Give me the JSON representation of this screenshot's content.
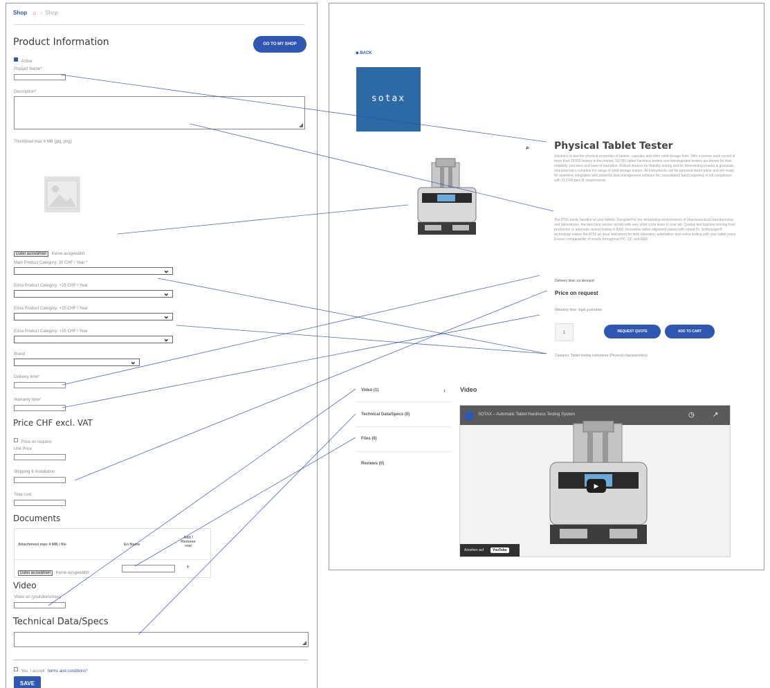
{
  "breadcrumb": {
    "shop": "Shop",
    "separator": "›",
    "current": "Shop"
  },
  "form": {
    "title": "Product Information",
    "go_to_shop": "GO TO MY SHOP",
    "active_label": "Active",
    "product_name_label": "Product Name*",
    "description_label": "Description*",
    "thumbnail_label": "Thumbnail max 4 MB (jpg, png)",
    "file_button": "Datei auswählen",
    "file_status": "Keine ausgewählt",
    "main_category_label": "Main Product Category: 30 CHF / Year *",
    "extra_category_label_1": "Extra Product Category: +25 CHF / Year",
    "extra_category_label_2": "Extra Product Category: +25 CHF / Year",
    "extra_category_label_3": "Extra Product Category: +25 CHF / Year",
    "brand_label": "Brand",
    "delivery_label": "Delivery time*",
    "warranty_label": "Warranty time*",
    "price_title": "Price CHF excl. VAT",
    "price_on_request": "Price on request",
    "unit_price_label": "Unit Price",
    "shipping_label": "Shipping & Installation",
    "total_label": "Total cost",
    "documents_title": "Documents",
    "doc_col_attachment": "Attachment max 4 MB / file",
    "doc_col_name": "En Name",
    "doc_col_add": "Add / Remove row",
    "doc_add_icon": "+",
    "video_title": "Video",
    "video_url_label": "Video url (youtube/vimeo)",
    "tech_title": "Technical Data/Specs",
    "accept_prefix": "Yes, I accept",
    "accept_link": "terms and conditions*",
    "save": "SAVE"
  },
  "preview": {
    "back": "◆ BACK",
    "logo_text": "sotax",
    "search_icon": "search-icon",
    "product_title": "Physical Tablet Tester",
    "desc_1": "Solutions to test the physical properties of tablets, capsules and other solid dosage form. With a proven track record of more than 25'000 testers in the market, SOTAX tablet hardness testers and disintegration testers are known for their reliability, precision and ease of operation. Robust devices for friability testing and for determining powder & granulate characteristics complete the range of solid dosage testers. All instruments can be operated stand-alone and are ready for seamless integration with powerful data management software for consolidated batch reporting in full compliance with 21 CFR part 11 requirements.",
    "desc_2": "The AT50 easily handles all your tablets. Designed for the demanding environments of pharmaceutical manufacturing and laboratories, the benchtop version avoids with very short cycle times in your lab. Quickly test batches arriving from production or automate repeat testing in R&D. Innovative tablet alignment paired with robust Dr. Schleuniger® technology makes the AT50 an ideal instrument for both laboratory automation and online testing with your tablet press. Ensure comparability of results throughout IPC, QC and R&D.",
    "delivery": "Delivery time: on demand",
    "price": "Price on request",
    "warranty": "Warranty time: legal guarantee",
    "qty": "1",
    "request_quote": "REQUEST QUOTE",
    "add_to_cart": "ADD TO CART",
    "category": "Category: Tablet testing instrument (Physical characteristics)",
    "tabs": [
      "Video (1)",
      "Technical Data/Specs (0)",
      "Files (0)",
      "Reviews (0)"
    ],
    "tab_chevron": "›",
    "video_heading": "Video",
    "video_title": "SOTAX – Automatic Tablet Hardness Testing System",
    "watch_on": "Ansehen auf",
    "youtube": "YouTube"
  },
  "colors": {
    "accent": "#2f56b0",
    "connector": "#2f4fb0",
    "logo_bg": "#2c6aa6"
  }
}
